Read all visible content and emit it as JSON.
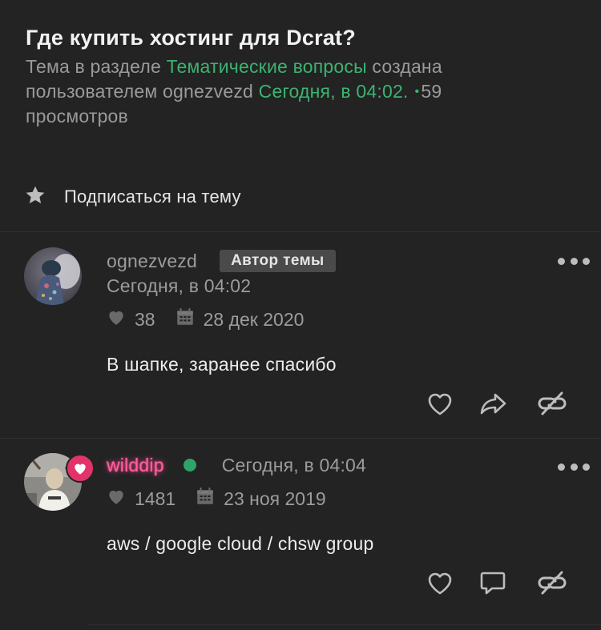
{
  "thread": {
    "title": "Где купить хостинг для Dcrat?",
    "meta_prefix": "Тема в разделе ",
    "section": "Тематические вопросы",
    "meta_created": " создана пользователем ognezvezd ",
    "created_time": "Сегодня, в 04:02.",
    "views_count": "59",
    "views_label": "просмотров"
  },
  "subscribe": {
    "label": "Подписаться на тему",
    "icon": "star-icon"
  },
  "posts": [
    {
      "author": "ognezvezd",
      "badge": "Автор темы",
      "time": "Сегодня, в 04:02",
      "likes": "38",
      "registered": "28 дек 2020",
      "body": "В шапке, заранее спасибо",
      "actions": [
        "heart-outline-icon",
        "share-icon",
        "quick-link-icon"
      ]
    },
    {
      "author": "wilddip",
      "time": "Сегодня, в 04:04",
      "likes": "1481",
      "registered": "23 ноя 2019",
      "body": "aws / google cloud / chsw group",
      "actions": [
        "heart-outline-icon",
        "reply-bubble-icon",
        "quick-link-icon"
      ]
    }
  ],
  "colors": {
    "background": "#232323",
    "accent": "#3cb371",
    "username_glow": "#ff5f9e",
    "online": "#2fa36b",
    "badge_bg": "#4a4a4a"
  }
}
